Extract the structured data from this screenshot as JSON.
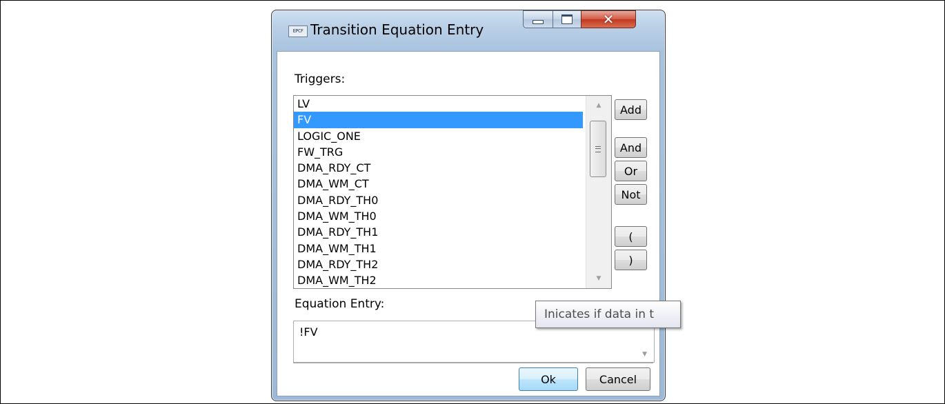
{
  "window": {
    "title": "Transition Equation Entry",
    "icon_text": "EPCF"
  },
  "triggers_label": "Triggers:",
  "triggers": [
    "LV",
    "FV",
    "LOGIC_ONE",
    "FW_TRG",
    "DMA_RDY_CT",
    "DMA_WM_CT",
    "DMA_RDY_TH0",
    "DMA_WM_TH0",
    "DMA_RDY_TH1",
    "DMA_WM_TH1",
    "DMA_RDY_TH2",
    "DMA_WM_TH2"
  ],
  "selected_trigger": "FV",
  "operator_buttons": {
    "add": "Add",
    "and": "And",
    "or": "Or",
    "not": "Not",
    "lparen": "(",
    "rparen": ")"
  },
  "equation_label": "Equation Entry:",
  "equation_value": "!FV",
  "buttons": {
    "ok": "Ok",
    "cancel": "Cancel"
  },
  "tooltip": "Inicates if data in t",
  "icons": {
    "minimize": "minimize-icon",
    "maximize": "maximize-icon",
    "close": "close-icon",
    "scroll_up": "chevron-up-icon",
    "scroll_down": "chevron-down-icon"
  },
  "colors": {
    "selection": "#3399ff",
    "title_bar": "#b9cfe6",
    "close_button": "#c2371f"
  }
}
